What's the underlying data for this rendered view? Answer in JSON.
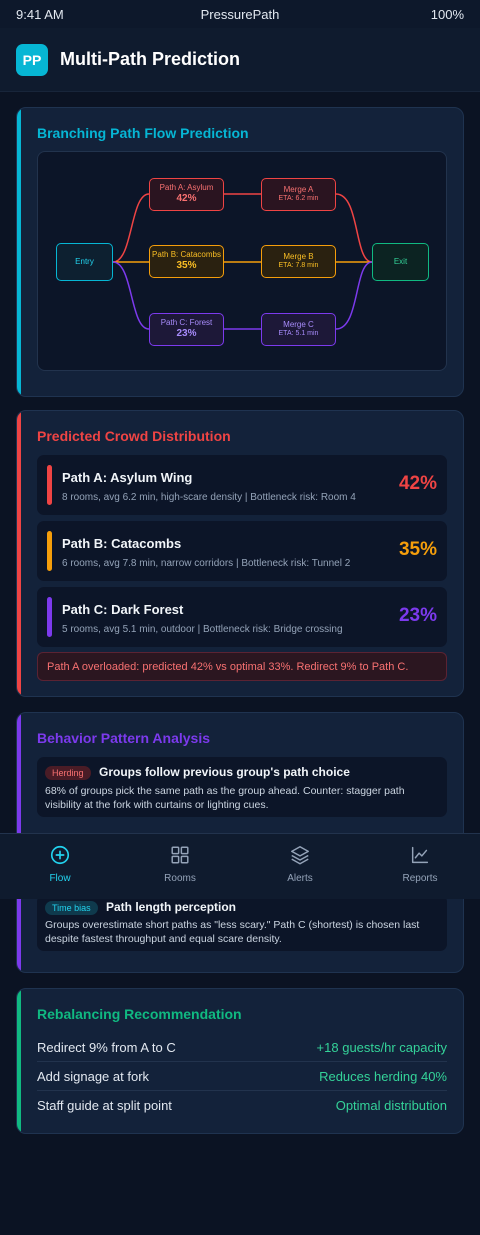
{
  "status_bar": {
    "time": "9:41 AM",
    "app_name": "PressurePath",
    "battery": "100%"
  },
  "header": {
    "logo": "PP",
    "title": "Multi-Path Prediction"
  },
  "flow_card": {
    "title": "Branching Path Flow Prediction",
    "nodes": {
      "entry": "Entry",
      "exit": "Exit",
      "path_a": {
        "name": "Path A: Asylum",
        "pct": "42%"
      },
      "path_b": {
        "name": "Path B: Catacombs",
        "pct": "35%"
      },
      "path_c": {
        "name": "Path C: Forest",
        "pct": "23%"
      },
      "merge_a": {
        "name": "Merge A",
        "eta": "ETA: 6.2 min"
      },
      "merge_b": {
        "name": "Merge B",
        "eta": "ETA: 7.8 min"
      },
      "merge_c": {
        "name": "Merge C",
        "eta": "ETA: 5.1 min"
      }
    }
  },
  "distribution": {
    "title": "Predicted Crowd Distribution",
    "paths": [
      {
        "name": "Path A: Asylum Wing",
        "desc": "8 rooms, avg 6.2 min, high-scare density | Bottleneck risk: Room 4",
        "pct": "42%",
        "color": "#ef4444"
      },
      {
        "name": "Path B: Catacombs",
        "desc": "6 rooms, avg 7.8 min, narrow corridors | Bottleneck risk: Tunnel 2",
        "pct": "35%",
        "color": "#f59e0b"
      },
      {
        "name": "Path C: Dark Forest",
        "desc": "5 rooms, avg 5.1 min, outdoor | Bottleneck risk: Bridge crossing",
        "pct": "23%",
        "color": "#7c3aed"
      }
    ],
    "alert": "Path A overloaded: predicted 42% vs optimal 33%. Redirect 9% to Path C."
  },
  "behavior": {
    "title": "Behavior Pattern Analysis",
    "items": [
      {
        "badge": "Herding",
        "title": "Groups follow previous group's path choice",
        "desc": "68% of groups pick the same path as the group ahead. Counter: stagger path visibility at the fork with curtains or lighting cues."
      },
      {
        "badge": "Time bias",
        "title": "Path length perception",
        "desc": "Groups overestimate short paths as \"less scary.\" Path C (shortest) is chosen last despite fastest throughput and equal scare density."
      }
    ]
  },
  "rebalancing": {
    "title": "Rebalancing Recommendation",
    "rows": [
      {
        "action": "Redirect 9% from A to C",
        "impact": "+18 guests/hr capacity"
      },
      {
        "action": "Add signage at fork",
        "impact": "Reduces herding 40%"
      },
      {
        "action": "Staff guide at split point",
        "impact": "Optimal distribution"
      }
    ]
  },
  "nav": {
    "items": [
      {
        "label": "Flow",
        "icon": "plus-circle-icon",
        "active": true
      },
      {
        "label": "Rooms",
        "icon": "grid-icon"
      },
      {
        "label": "Alerts",
        "icon": "layers-icon"
      },
      {
        "label": "Reports",
        "icon": "trend-chart-icon"
      }
    ]
  },
  "colors": {
    "cyan": "#06b6d4",
    "red": "#ef4444",
    "amber": "#f59e0b",
    "purple": "#7c3aed",
    "green": "#10b981",
    "background": "#0b1323"
  }
}
